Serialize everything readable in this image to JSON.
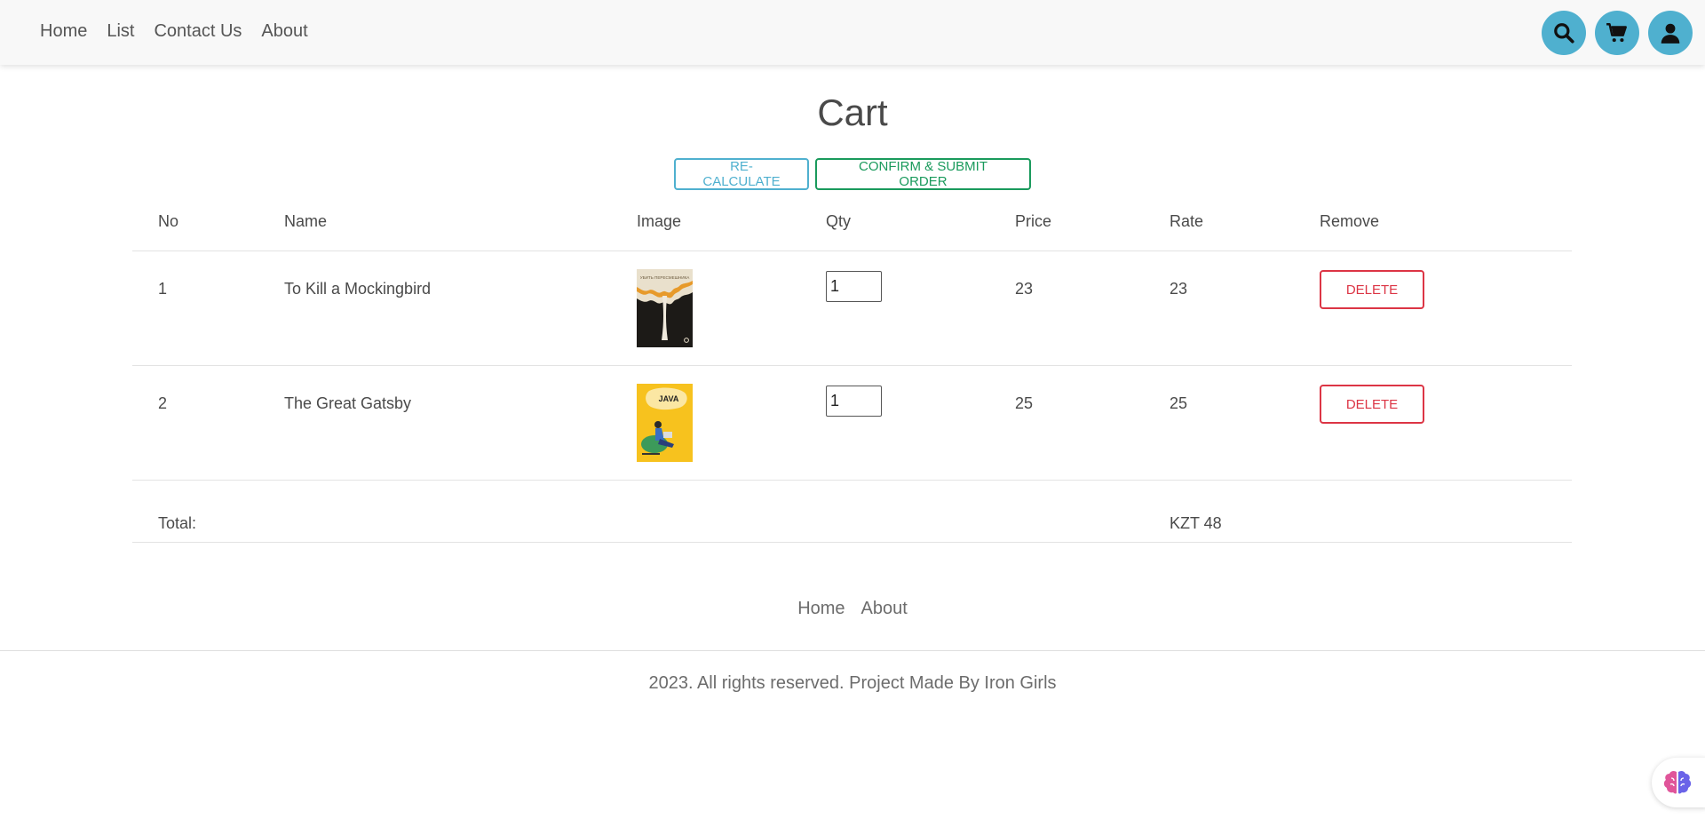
{
  "nav": {
    "links": [
      "Home",
      "List",
      "Contact Us",
      "About"
    ],
    "icons": [
      "search-icon",
      "cart-icon",
      "user-icon"
    ],
    "accent_color": "#4fb0cf"
  },
  "page": {
    "title": "Cart",
    "recalculate_label": "RE-CALCULATE",
    "confirm_label": "CONFIRM & SUBMIT ORDER"
  },
  "table": {
    "headers": {
      "no": "No",
      "name": "Name",
      "image": "Image",
      "qty": "Qty",
      "price": "Price",
      "rate": "Rate",
      "remove": "Remove"
    },
    "rows": [
      {
        "no": "1",
        "name": "To Kill a Mockingbird",
        "qty": "1",
        "price": "23",
        "rate": "23",
        "delete_label": "DELETE",
        "cover_title": "УБИТЬ ПЕРЕСМЕШНИКА"
      },
      {
        "no": "2",
        "name": "The Great Gatsby",
        "qty": "1",
        "price": "25",
        "rate": "25",
        "delete_label": "DELETE",
        "cover_title": "JAVA"
      }
    ],
    "total_label": "Total:",
    "total_value": "KZT 48"
  },
  "footer": {
    "links": [
      "Home",
      "About"
    ],
    "copyright": "2023. All rights reserved. Project Made By Iron Girls"
  },
  "colors": {
    "delete": "#dc3545",
    "confirm": "#1a9a5c",
    "recalculate": "#4fb0cf"
  }
}
